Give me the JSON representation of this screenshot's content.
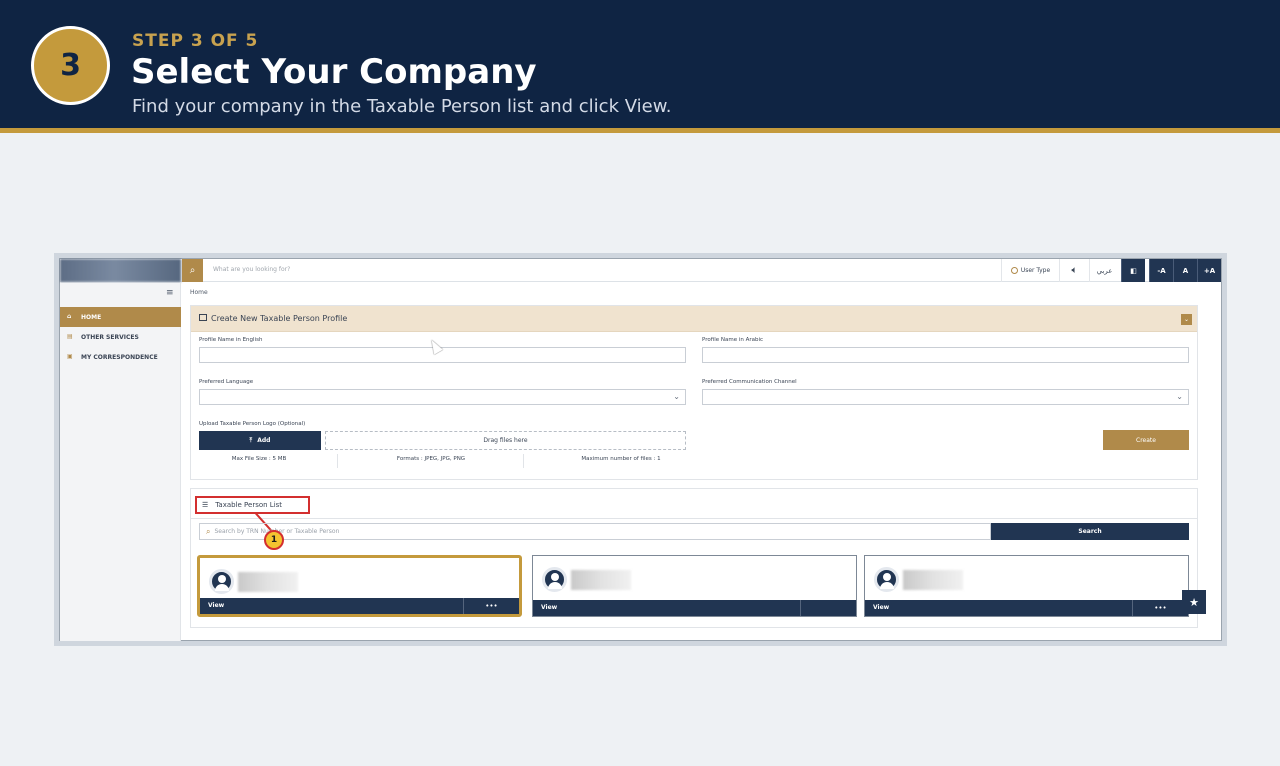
{
  "step": {
    "number": "3",
    "kicker": "STEP 3 OF 5",
    "title": "Select Your Company",
    "subtitle": "Find your company in the Taxable Person list and click View."
  },
  "portal": {
    "search_placeholder": "What are you looking for?",
    "topbar": {
      "user_type": "User Type",
      "language": "عربي",
      "font_decrease": "-A",
      "font_normal": "A",
      "font_increase": "+A"
    },
    "sidebar": {
      "items": [
        {
          "label": "HOME",
          "icon": "home-icon",
          "active": true
        },
        {
          "label": "OTHER SERVICES",
          "icon": "document-icon",
          "active": false
        },
        {
          "label": "MY CORRESPONDENCE",
          "icon": "mail-icon",
          "active": false
        }
      ]
    },
    "breadcrumb": "Home",
    "create_panel": {
      "title": "Create New Taxable Person Profile",
      "name_en_label": "Profile Name in English",
      "name_ar_label": "Profile Name in Arabic",
      "pref_lang_label": "Preferred Language",
      "pref_channel_label": "Preferred Communication Channel",
      "logo_label": "Upload Taxable Person Logo (Optional)",
      "add_label": "Add",
      "drop_label": "Drag files here",
      "create_label": "Create",
      "max_size": "Max File Size : 5 MB",
      "formats": "Formats : JPEG, JPG, PNG",
      "max_files": "Maximum number of files : 1"
    },
    "list_panel": {
      "title": "Taxable Person List",
      "search_placeholder": "Search by TRN Number or Taxable Person",
      "search_label": "Search",
      "callout": "1",
      "cards": [
        {
          "view_label": "View",
          "more_label": "•••",
          "highlighted": true
        },
        {
          "view_label": "View",
          "more_label": "",
          "highlighted": false
        },
        {
          "view_label": "View",
          "more_label": "•••",
          "highlighted": false
        }
      ]
    }
  },
  "colors": {
    "header_navy": "#0f2443",
    "accent_gold": "#c49a3c",
    "portal_navy": "#213552",
    "portal_gold": "#b08a4a",
    "callout_red": "#d32f2f"
  }
}
